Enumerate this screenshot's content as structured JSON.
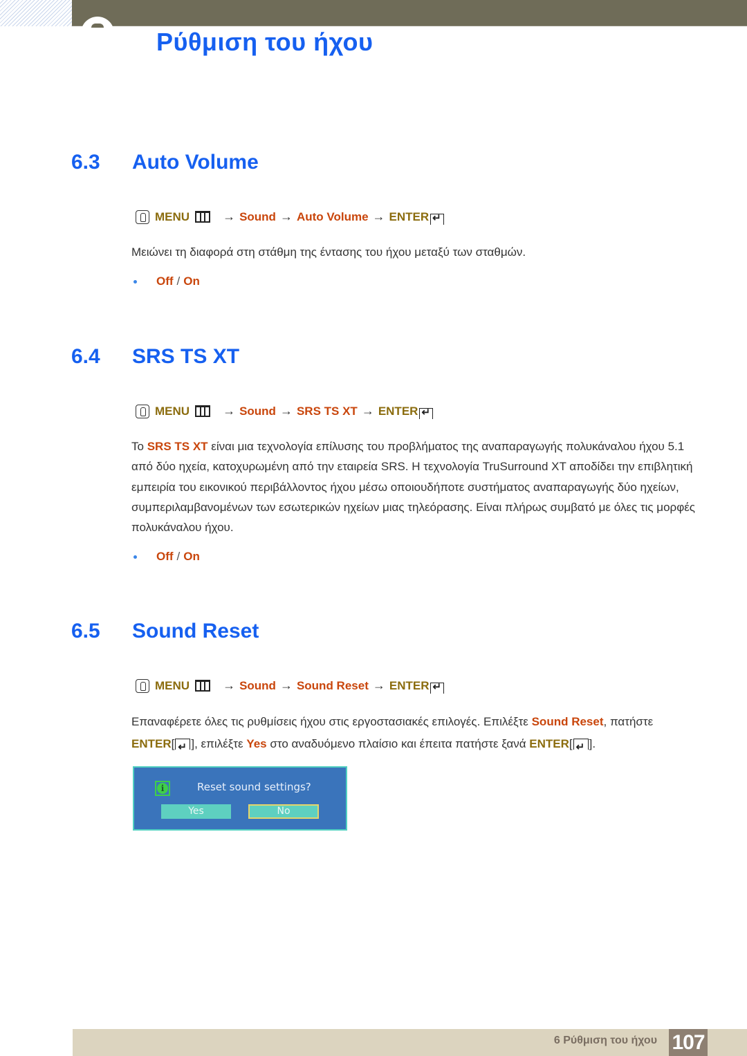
{
  "chapter": {
    "title": "Ρύθμιση του ήχου"
  },
  "sections": [
    {
      "number": "6.3",
      "title": "Auto Volume",
      "menu_path": {
        "menu": "MENU",
        "arrow": "→",
        "step1": "Sound",
        "step2": "Auto Volume",
        "enter": "ENTER"
      },
      "description": "Μειώνει τη διαφορά στη στάθμη της έντασης του ήχου μεταξύ των σταθμών.",
      "options": {
        "off": "Off",
        "separator": "/",
        "on": "On"
      }
    },
    {
      "number": "6.4",
      "title": "SRS TS XT",
      "menu_path": {
        "menu": "MENU",
        "arrow": "→",
        "step1": "Sound",
        "step2": "SRS TS XT",
        "enter": "ENTER"
      },
      "description_prefix": "Το ",
      "description_highlight": "SRS TS XT",
      "description_rest": " είναι μια τεχνολογία επίλυσης του προβλήματος της αναπαραγωγής πολυκάναλου ήχου 5.1 από δύο ηχεία, κατοχυρωμένη από την εταιρεία SRS. Η τεχνολογία TruSurround XT αποδίδει την επιβλητική εμπειρία του εικονικού περιβάλλοντος ήχου μέσω οποιουδήποτε συστήματος αναπαραγωγής δύο ηχείων, συμπεριλαμβανομένων των εσωτερικών ηχείων μιας τηλεόρασης. Είναι πλήρως συμβατό με όλες τις μορφές πολυκάναλου ήχου.",
      "options": {
        "off": "Off",
        "separator": "/",
        "on": "On"
      }
    },
    {
      "number": "6.5",
      "title": "Sound Reset",
      "menu_path": {
        "menu": "MENU",
        "arrow": "→",
        "step1": "Sound",
        "step2": "Sound Reset",
        "enter": "ENTER"
      },
      "desc_part1": "Επαναφέρετε όλες τις ρυθμίσεις ήχου στις εργοστασιακές επιλογές. Επιλέξτε ",
      "desc_hl1": "Sound Reset",
      "desc_part2": ", πατήστε ",
      "desc_enter1": "ENTER",
      "desc_part3": "], επιλέξτε ",
      "desc_hl2": "Yes",
      "desc_part4": " στο αναδυόμενο πλαίσιο και έπειτα πατήστε ξανά ",
      "desc_enter2": "ENTER",
      "desc_part5": "].",
      "bracket_open": "[",
      "dialog": {
        "message": "Reset sound settings?",
        "yes_label": "Yes",
        "no_label": "No",
        "focused": "No"
      }
    }
  ],
  "footer": {
    "chapter_label": "6 Ρύθμιση του ήχου",
    "page_number": "107"
  },
  "colors": {
    "heading_blue": "#1660f0",
    "menu_olive": "#8b6c0e",
    "highlight_orange": "#c9460c",
    "topbar": "#6f6c58",
    "footer_bg": "#dcd4bf",
    "page_badge": "#8e8072",
    "dialog_bg": "#3a74bb",
    "dialog_button": "#5ed0c0"
  }
}
